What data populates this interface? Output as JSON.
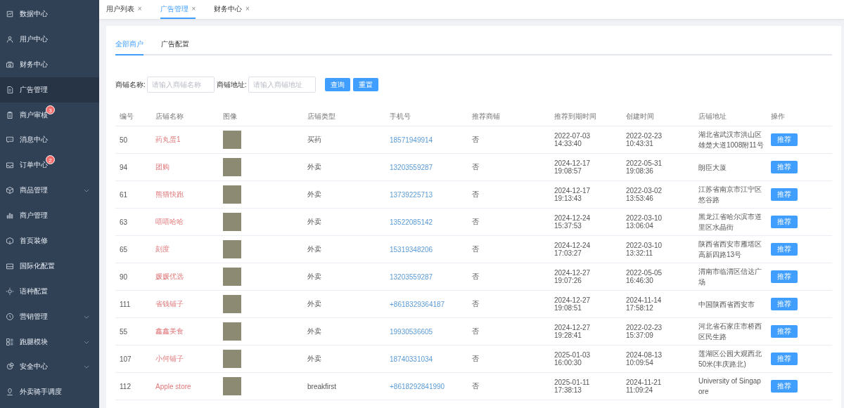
{
  "sidebar": {
    "items": [
      {
        "label": "数据中心",
        "selected": false
      },
      {
        "label": "用户中心",
        "selected": false
      },
      {
        "label": "财务中心",
        "selected": false
      },
      {
        "label": "广告管理",
        "selected": true
      },
      {
        "label": "商户审核",
        "selected": false,
        "badge": "3"
      },
      {
        "label": "消息中心",
        "selected": false
      },
      {
        "label": "订单中心",
        "selected": false,
        "badge": "2"
      },
      {
        "label": "商品管理",
        "selected": false,
        "expandable": true
      },
      {
        "label": "商户管理",
        "selected": false
      },
      {
        "label": "首页装修",
        "selected": false
      },
      {
        "label": "国际化配置",
        "selected": false
      },
      {
        "label": "语种配置",
        "selected": false
      },
      {
        "label": "营销管理",
        "selected": false,
        "expandable": true
      },
      {
        "label": "跑腿模块",
        "selected": false,
        "expandable": true
      },
      {
        "label": "安全中心",
        "selected": false,
        "expandable": true
      },
      {
        "label": "外卖骑手调度",
        "selected": false
      }
    ]
  },
  "tabs": [
    {
      "label": "用户列表",
      "close": "×",
      "selected": false
    },
    {
      "label": "广告管理",
      "close": "×",
      "selected": true
    },
    {
      "label": "财务中心",
      "close": "×",
      "selected": false
    }
  ],
  "subtabs": [
    {
      "label": "全部商户",
      "selected": true
    },
    {
      "label": "广告配置",
      "selected": false
    }
  ],
  "search": {
    "fields": [
      {
        "label": "商铺名称:",
        "placeholder": "请输入商铺名称"
      },
      {
        "label": "商铺地址:",
        "placeholder": "请输入商铺地址"
      }
    ],
    "buttons": [
      "查询",
      "重置"
    ]
  },
  "table": {
    "columns": [
      "编号",
      "店铺名称",
      "图像",
      "店铺类型",
      "手机号",
      "推荐商铺",
      "推荐到期时间",
      "创建时间",
      "店铺地址",
      "操作"
    ],
    "rows": [
      {
        "id": "50",
        "name": "药丸蛋1",
        "type": "买药",
        "phone": "18571949914",
        "recommended": "否",
        "expires": "2022-07-03 14:33:40",
        "created": "2022-02-23 10:43:31",
        "address": "湖北省武汉市洪山区雄楚大道1008附11号",
        "action": "推荐"
      },
      {
        "id": "94",
        "name": "团购",
        "type": "外卖",
        "phone": "13203559287",
        "recommended": "否",
        "expires": "2024-12-17 19:08:57",
        "created": "2022-05-31 19:08:36",
        "address": "朗臣大厦",
        "action": "推荐"
      },
      {
        "id": "61",
        "name": "熊猫快跑",
        "type": "外卖",
        "phone": "13739225713",
        "recommended": "否",
        "expires": "2024-12-17 19:13:43",
        "created": "2022-03-02 13:53:46",
        "address": "江苏省南京市江宁区悠谷路",
        "action": "推荐"
      },
      {
        "id": "63",
        "name": "嘻嘻哈哈",
        "type": "外卖",
        "phone": "13522085142",
        "recommended": "否",
        "expires": "2024-12-24 15:37:53",
        "created": "2022-03-10 13:06:04",
        "address": "黑龙江省哈尔滨市道里区水晶街",
        "action": "推荐"
      },
      {
        "id": "65",
        "name": "刻度",
        "type": "外卖",
        "phone": "15319348206",
        "recommended": "否",
        "expires": "2024-12-24 17:03:27",
        "created": "2022-03-10 13:32:11",
        "address": "陕西省西安市雁塔区高新四路13号",
        "action": "推荐"
      },
      {
        "id": "90",
        "name": "媛媛优选",
        "type": "外卖",
        "phone": "13203559287",
        "recommended": "否",
        "expires": "2024-12-27 19:07:26",
        "created": "2022-05-05 16:46:30",
        "address": "渭南市临渭区信达广场",
        "action": "推荐"
      },
      {
        "id": "111",
        "name": "省钱铺子",
        "type": "外卖",
        "phone": "+8618329364187",
        "recommended": "否",
        "expires": "2024-12-27 19:08:51",
        "created": "2024-11-14 17:58:12",
        "address": "中国陕西省西安市",
        "action": "推荐"
      },
      {
        "id": "55",
        "name": "鑫鑫美食",
        "type": "外卖",
        "phone": "19930536605",
        "recommended": "否",
        "expires": "2024-12-27 19:28:41",
        "created": "2022-02-23 15:37:09",
        "address": "河北省石家庄市桥西区民生路",
        "action": "推荐"
      },
      {
        "id": "107",
        "name": "小何铺子",
        "type": "外卖",
        "phone": "18740331034",
        "recommended": "否",
        "expires": "2025-01-03 16:00:30",
        "created": "2024-08-13 10:09:54",
        "address": "莲湖区公园大观西北50米(丰庆路北)",
        "action": "推荐"
      },
      {
        "id": "112",
        "name": "Apple store",
        "type": "breakfirst",
        "phone": "+8618292841990",
        "recommended": "否",
        "expires": "2025-01-11 17:38:13",
        "created": "2024-11-21 11:09:24",
        "address": "University of Singapore",
        "action": "推荐"
      }
    ]
  }
}
